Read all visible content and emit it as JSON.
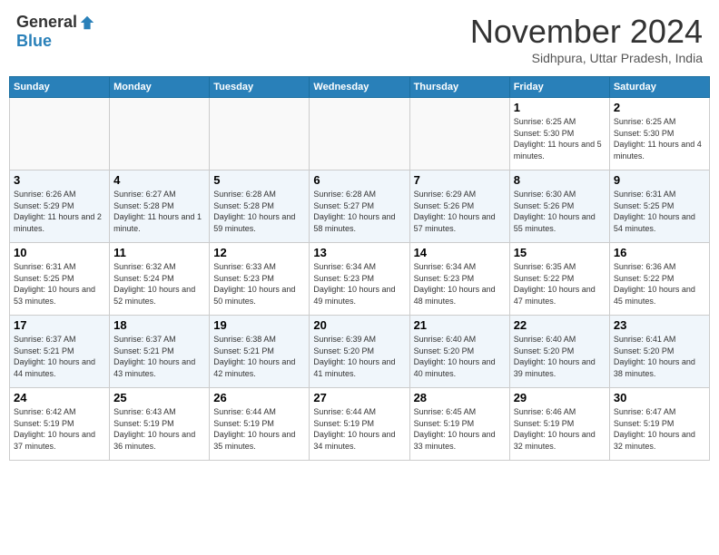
{
  "logo": {
    "general": "General",
    "blue": "Blue"
  },
  "title": "November 2024",
  "location": "Sidhpura, Uttar Pradesh, India",
  "days_of_week": [
    "Sunday",
    "Monday",
    "Tuesday",
    "Wednesday",
    "Thursday",
    "Friday",
    "Saturday"
  ],
  "weeks": [
    [
      {
        "day": "",
        "info": ""
      },
      {
        "day": "",
        "info": ""
      },
      {
        "day": "",
        "info": ""
      },
      {
        "day": "",
        "info": ""
      },
      {
        "day": "",
        "info": ""
      },
      {
        "day": "1",
        "info": "Sunrise: 6:25 AM\nSunset: 5:30 PM\nDaylight: 11 hours and 5 minutes."
      },
      {
        "day": "2",
        "info": "Sunrise: 6:25 AM\nSunset: 5:30 PM\nDaylight: 11 hours and 4 minutes."
      }
    ],
    [
      {
        "day": "3",
        "info": "Sunrise: 6:26 AM\nSunset: 5:29 PM\nDaylight: 11 hours and 2 minutes."
      },
      {
        "day": "4",
        "info": "Sunrise: 6:27 AM\nSunset: 5:28 PM\nDaylight: 11 hours and 1 minute."
      },
      {
        "day": "5",
        "info": "Sunrise: 6:28 AM\nSunset: 5:28 PM\nDaylight: 10 hours and 59 minutes."
      },
      {
        "day": "6",
        "info": "Sunrise: 6:28 AM\nSunset: 5:27 PM\nDaylight: 10 hours and 58 minutes."
      },
      {
        "day": "7",
        "info": "Sunrise: 6:29 AM\nSunset: 5:26 PM\nDaylight: 10 hours and 57 minutes."
      },
      {
        "day": "8",
        "info": "Sunrise: 6:30 AM\nSunset: 5:26 PM\nDaylight: 10 hours and 55 minutes."
      },
      {
        "day": "9",
        "info": "Sunrise: 6:31 AM\nSunset: 5:25 PM\nDaylight: 10 hours and 54 minutes."
      }
    ],
    [
      {
        "day": "10",
        "info": "Sunrise: 6:31 AM\nSunset: 5:25 PM\nDaylight: 10 hours and 53 minutes."
      },
      {
        "day": "11",
        "info": "Sunrise: 6:32 AM\nSunset: 5:24 PM\nDaylight: 10 hours and 52 minutes."
      },
      {
        "day": "12",
        "info": "Sunrise: 6:33 AM\nSunset: 5:23 PM\nDaylight: 10 hours and 50 minutes."
      },
      {
        "day": "13",
        "info": "Sunrise: 6:34 AM\nSunset: 5:23 PM\nDaylight: 10 hours and 49 minutes."
      },
      {
        "day": "14",
        "info": "Sunrise: 6:34 AM\nSunset: 5:23 PM\nDaylight: 10 hours and 48 minutes."
      },
      {
        "day": "15",
        "info": "Sunrise: 6:35 AM\nSunset: 5:22 PM\nDaylight: 10 hours and 47 minutes."
      },
      {
        "day": "16",
        "info": "Sunrise: 6:36 AM\nSunset: 5:22 PM\nDaylight: 10 hours and 45 minutes."
      }
    ],
    [
      {
        "day": "17",
        "info": "Sunrise: 6:37 AM\nSunset: 5:21 PM\nDaylight: 10 hours and 44 minutes."
      },
      {
        "day": "18",
        "info": "Sunrise: 6:37 AM\nSunset: 5:21 PM\nDaylight: 10 hours and 43 minutes."
      },
      {
        "day": "19",
        "info": "Sunrise: 6:38 AM\nSunset: 5:21 PM\nDaylight: 10 hours and 42 minutes."
      },
      {
        "day": "20",
        "info": "Sunrise: 6:39 AM\nSunset: 5:20 PM\nDaylight: 10 hours and 41 minutes."
      },
      {
        "day": "21",
        "info": "Sunrise: 6:40 AM\nSunset: 5:20 PM\nDaylight: 10 hours and 40 minutes."
      },
      {
        "day": "22",
        "info": "Sunrise: 6:40 AM\nSunset: 5:20 PM\nDaylight: 10 hours and 39 minutes."
      },
      {
        "day": "23",
        "info": "Sunrise: 6:41 AM\nSunset: 5:20 PM\nDaylight: 10 hours and 38 minutes."
      }
    ],
    [
      {
        "day": "24",
        "info": "Sunrise: 6:42 AM\nSunset: 5:19 PM\nDaylight: 10 hours and 37 minutes."
      },
      {
        "day": "25",
        "info": "Sunrise: 6:43 AM\nSunset: 5:19 PM\nDaylight: 10 hours and 36 minutes."
      },
      {
        "day": "26",
        "info": "Sunrise: 6:44 AM\nSunset: 5:19 PM\nDaylight: 10 hours and 35 minutes."
      },
      {
        "day": "27",
        "info": "Sunrise: 6:44 AM\nSunset: 5:19 PM\nDaylight: 10 hours and 34 minutes."
      },
      {
        "day": "28",
        "info": "Sunrise: 6:45 AM\nSunset: 5:19 PM\nDaylight: 10 hours and 33 minutes."
      },
      {
        "day": "29",
        "info": "Sunrise: 6:46 AM\nSunset: 5:19 PM\nDaylight: 10 hours and 32 minutes."
      },
      {
        "day": "30",
        "info": "Sunrise: 6:47 AM\nSunset: 5:19 PM\nDaylight: 10 hours and 32 minutes."
      }
    ]
  ]
}
